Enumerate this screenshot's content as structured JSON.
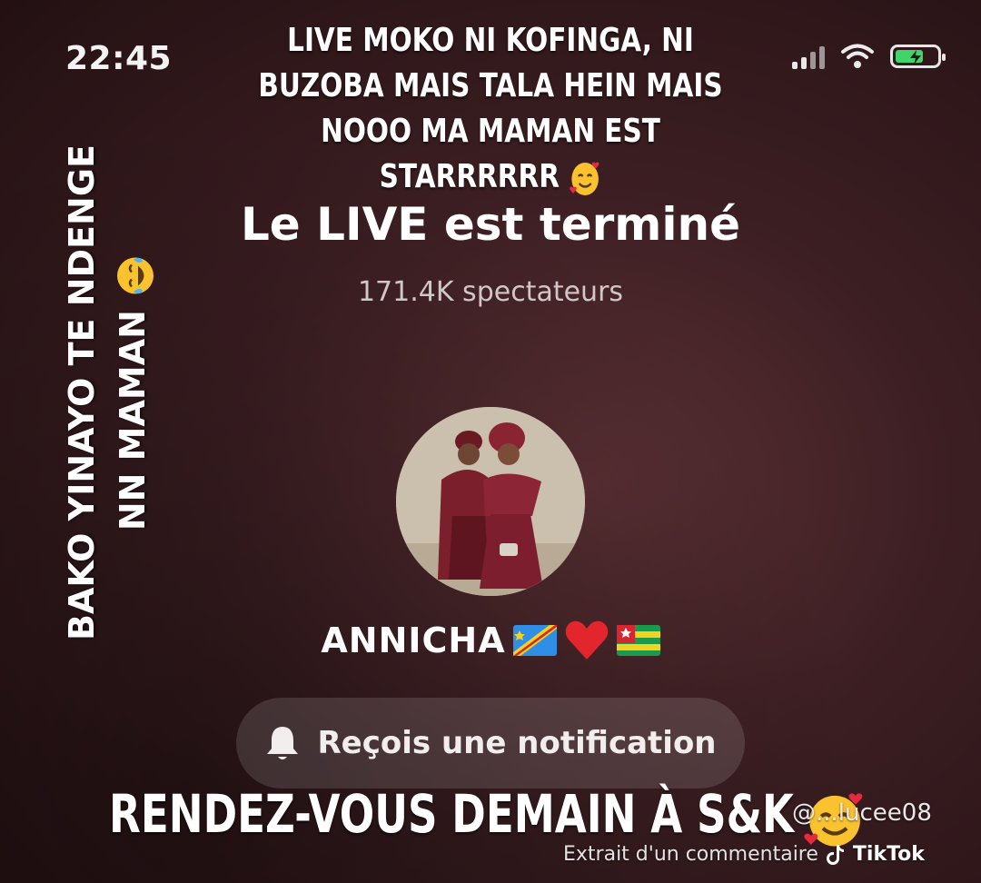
{
  "status_bar": {
    "time": "22:45",
    "icons": [
      "signal-icon",
      "wifi-icon",
      "battery-charging-icon"
    ],
    "battery_color": "#41d46b"
  },
  "captions": {
    "top": "Live moko ni kofinga, ni buzoba mais Tala hein mais nooo ma maman est starrrrrr",
    "top_emoji": "smiling-face-with-hearts-icon",
    "side": "Bako yinayo te ndenge nn maman",
    "side_emoji": "crying-laughing-icon",
    "bottom": "Rendez-vous demain à S&K",
    "bottom_emoji": "smiling-face-with-hearts-icon"
  },
  "live_end": {
    "title": "Le LIVE est terminé",
    "viewers": "171.4K spectateurs",
    "username": "ANNICHA",
    "username_emojis": [
      "drc-flag-icon",
      "red-heart-icon",
      "togo-flag-icon"
    ],
    "notify_label": "Reçois une notification",
    "notify_icon": "bell-icon"
  },
  "watermark": {
    "user": "@...lucee08",
    "extract": "Extrait d'un commentaire",
    "brand": "TikTok",
    "brand_icon": "tiktok-logo-icon"
  }
}
